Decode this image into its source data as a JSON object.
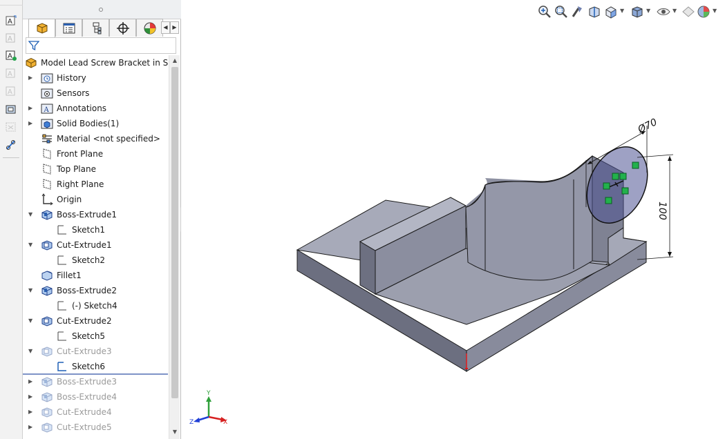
{
  "feature_tree": {
    "root_label": "Model Lead Screw Bracket in SolidW",
    "items": [
      {
        "label": "History",
        "icon": "history-folder-icon",
        "expandable": true,
        "suppressed": false
      },
      {
        "label": "Sensors",
        "icon": "sensors-folder-icon",
        "expandable": false,
        "suppressed": false
      },
      {
        "label": "Annotations",
        "icon": "annotations-folder-icon",
        "expandable": true,
        "suppressed": false
      },
      {
        "label": "Solid Bodies(1)",
        "icon": "solid-bodies-folder-icon",
        "expandable": true,
        "suppressed": false
      },
      {
        "label": "Material <not specified>",
        "icon": "material-icon",
        "expandable": false,
        "suppressed": false
      },
      {
        "label": "Front Plane",
        "icon": "plane-icon",
        "expandable": false,
        "suppressed": false
      },
      {
        "label": "Top Plane",
        "icon": "plane-icon",
        "expandable": false,
        "suppressed": false
      },
      {
        "label": "Right Plane",
        "icon": "plane-icon",
        "expandable": false,
        "suppressed": false
      },
      {
        "label": "Origin",
        "icon": "origin-icon",
        "expandable": false,
        "suppressed": false
      },
      {
        "label": "Boss-Extrude1",
        "icon": "boss-extrude-icon",
        "expandable": true,
        "suppressed": false
      },
      {
        "label": "Sketch1",
        "icon": "sketch-icon",
        "expandable": false,
        "suppressed": false
      },
      {
        "label": "Cut-Extrude1",
        "icon": "cut-extrude-icon",
        "expandable": true,
        "suppressed": false
      },
      {
        "label": "Sketch2",
        "icon": "sketch-icon",
        "expandable": false,
        "suppressed": false
      },
      {
        "label": "Fillet1",
        "icon": "fillet-icon",
        "expandable": false,
        "suppressed": false
      },
      {
        "label": "Boss-Extrude2",
        "icon": "boss-extrude-icon",
        "expandable": true,
        "suppressed": false
      },
      {
        "label": "(-) Sketch4",
        "icon": "sketch-icon",
        "expandable": false,
        "suppressed": false
      },
      {
        "label": "Cut-Extrude2",
        "icon": "cut-extrude-icon",
        "expandable": true,
        "suppressed": false
      },
      {
        "label": "Sketch5",
        "icon": "sketch-icon",
        "expandable": false,
        "suppressed": false
      },
      {
        "label": "Cut-Extrude3",
        "icon": "cut-extrude-icon",
        "expandable": true,
        "suppressed": true
      },
      {
        "label": "Sketch6",
        "icon": "sketch-active-icon",
        "expandable": false,
        "suppressed": false
      },
      {
        "label": "Boss-Extrude3",
        "icon": "boss-extrude-icon",
        "expandable": true,
        "suppressed": true
      },
      {
        "label": "Boss-Extrude4",
        "icon": "boss-extrude-icon",
        "expandable": true,
        "suppressed": true
      },
      {
        "label": "Cut-Extrude4",
        "icon": "cut-extrude-icon",
        "expandable": true,
        "suppressed": true
      },
      {
        "label": "Cut-Extrude5",
        "icon": "cut-extrude-icon",
        "expandable": true,
        "suppressed": true
      }
    ]
  },
  "tabs": [
    {
      "icon": "feature-manager-icon",
      "active": true
    },
    {
      "icon": "property-manager-icon",
      "active": false
    },
    {
      "icon": "configuration-manager-icon",
      "active": false
    },
    {
      "icon": "dimxpert-manager-icon",
      "active": false
    },
    {
      "icon": "display-manager-icon",
      "active": false
    }
  ],
  "dimensions": {
    "diameter": "Ø70",
    "length": "100"
  },
  "triad": {
    "x": "X",
    "y": "Y",
    "z": "Z"
  },
  "colors": {
    "model_face_top": "#a6a9b8",
    "model_face_side": "#7e8193",
    "model_face_dark": "#676a7a",
    "sketch_circle": "#5a5f9e",
    "relation_green": "#22b14c",
    "suppressed_text": "#9a9a9a"
  }
}
